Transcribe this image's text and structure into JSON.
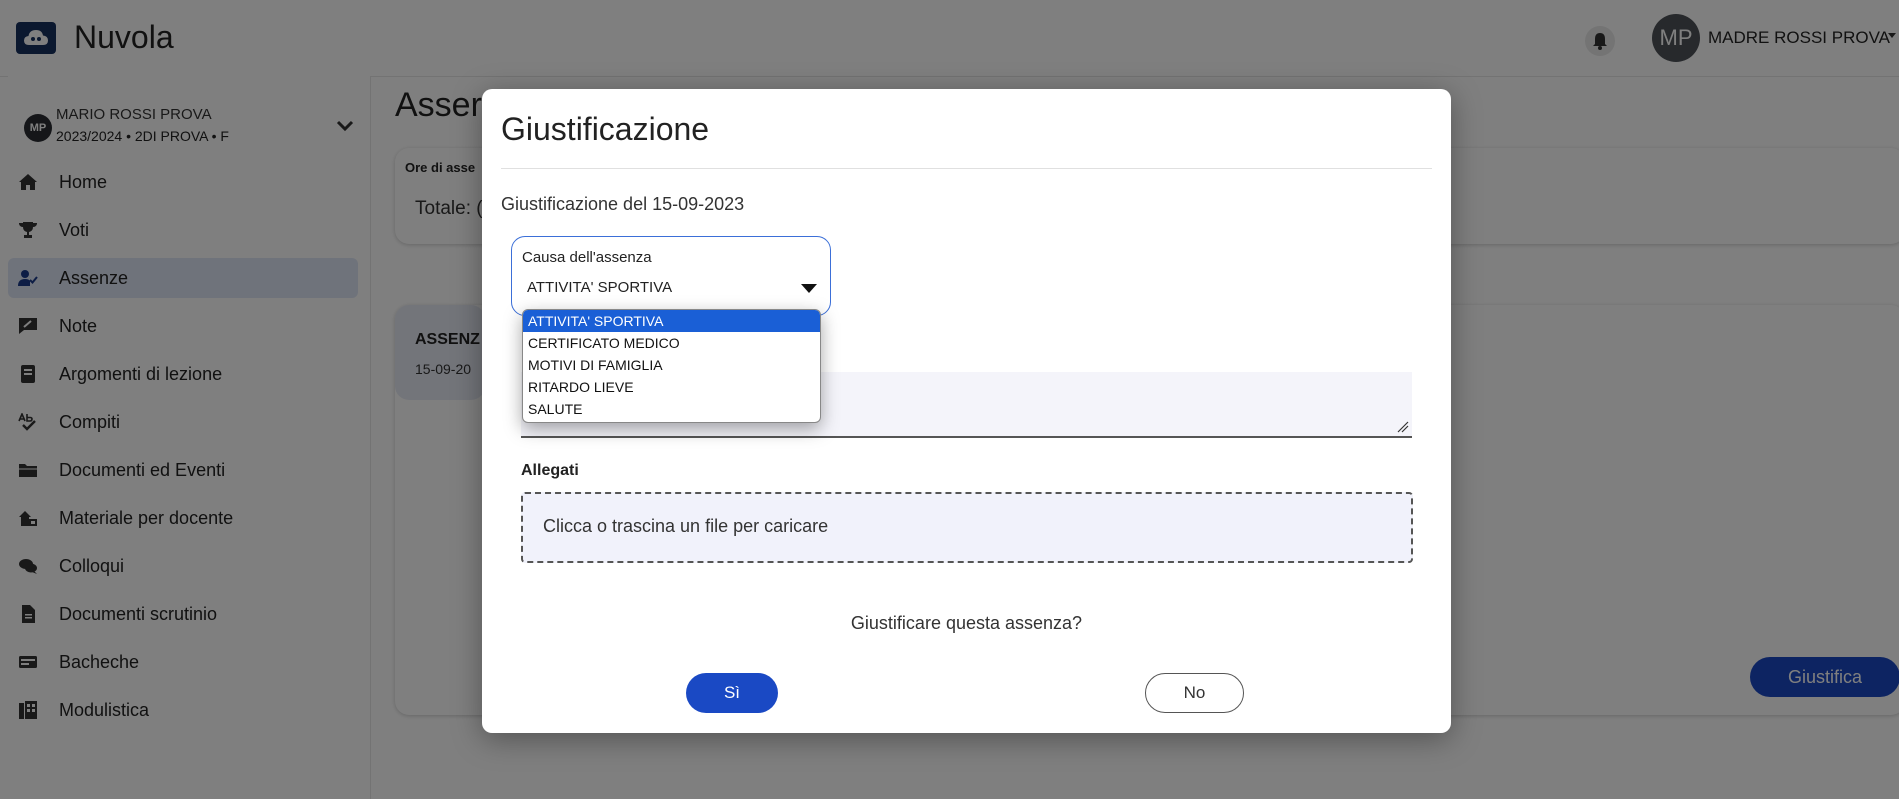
{
  "app": {
    "title": "Nuvola"
  },
  "header": {
    "user_initials": "MP",
    "user_name": "MADRE ROSSI PROVA"
  },
  "student": {
    "initials": "MP",
    "name": "MARIO ROSSI PROVA",
    "details": "2023/2024 • 2DI PROVA • F"
  },
  "sidebar": {
    "items": [
      {
        "label": "Home",
        "icon": "home-icon"
      },
      {
        "label": "Voti",
        "icon": "trophy-icon"
      },
      {
        "label": "Assenze",
        "icon": "user-check-icon",
        "active": true
      },
      {
        "label": "Note",
        "icon": "note-icon"
      },
      {
        "label": "Argomenti di lezione",
        "icon": "book-icon"
      },
      {
        "label": "Compiti",
        "icon": "spellcheck-icon"
      },
      {
        "label": "Documenti ed Eventi",
        "icon": "folder-icon"
      },
      {
        "label": "Materiale per docente",
        "icon": "material-icon"
      },
      {
        "label": "Colloqui",
        "icon": "chat-icon"
      },
      {
        "label": "Documenti scrutinio",
        "icon": "document-icon"
      },
      {
        "label": "Bacheche",
        "icon": "board-icon"
      },
      {
        "label": "Modulistica",
        "icon": "forms-icon"
      }
    ]
  },
  "main": {
    "title": "Asser",
    "card_header": "Ore di asse",
    "total": "Totale: (",
    "absence_title": "ASSENZ",
    "absence_date": "15-09-20",
    "justify_button": "Giustifica"
  },
  "modal": {
    "title": "Giustificazione",
    "subtitle": "Giustificazione del 15-09-2023",
    "select_label": "Causa dell'assenza",
    "select_value": "ATTIVITA' SPORTIVA",
    "options": [
      "ATTIVITA' SPORTIVA",
      "CERTIFICATO MEDICO",
      "MOTIVI DI FAMIGLIA",
      "RITARDO LIEVE",
      "SALUTE"
    ],
    "selected_option": "ATTIVITA' SPORTIVA",
    "attachments_label": "Allegati",
    "dropzone_text": "Clicca o trascina un file per caricare",
    "confirm_question": "Giustificare questa assenza?",
    "yes_label": "Sì",
    "no_label": "No"
  },
  "colors": {
    "primary": "#1a49c4",
    "logo": "#17305e",
    "active_nav_bg": "#dfe6f6",
    "option_highlight": "#1a5fd6"
  }
}
